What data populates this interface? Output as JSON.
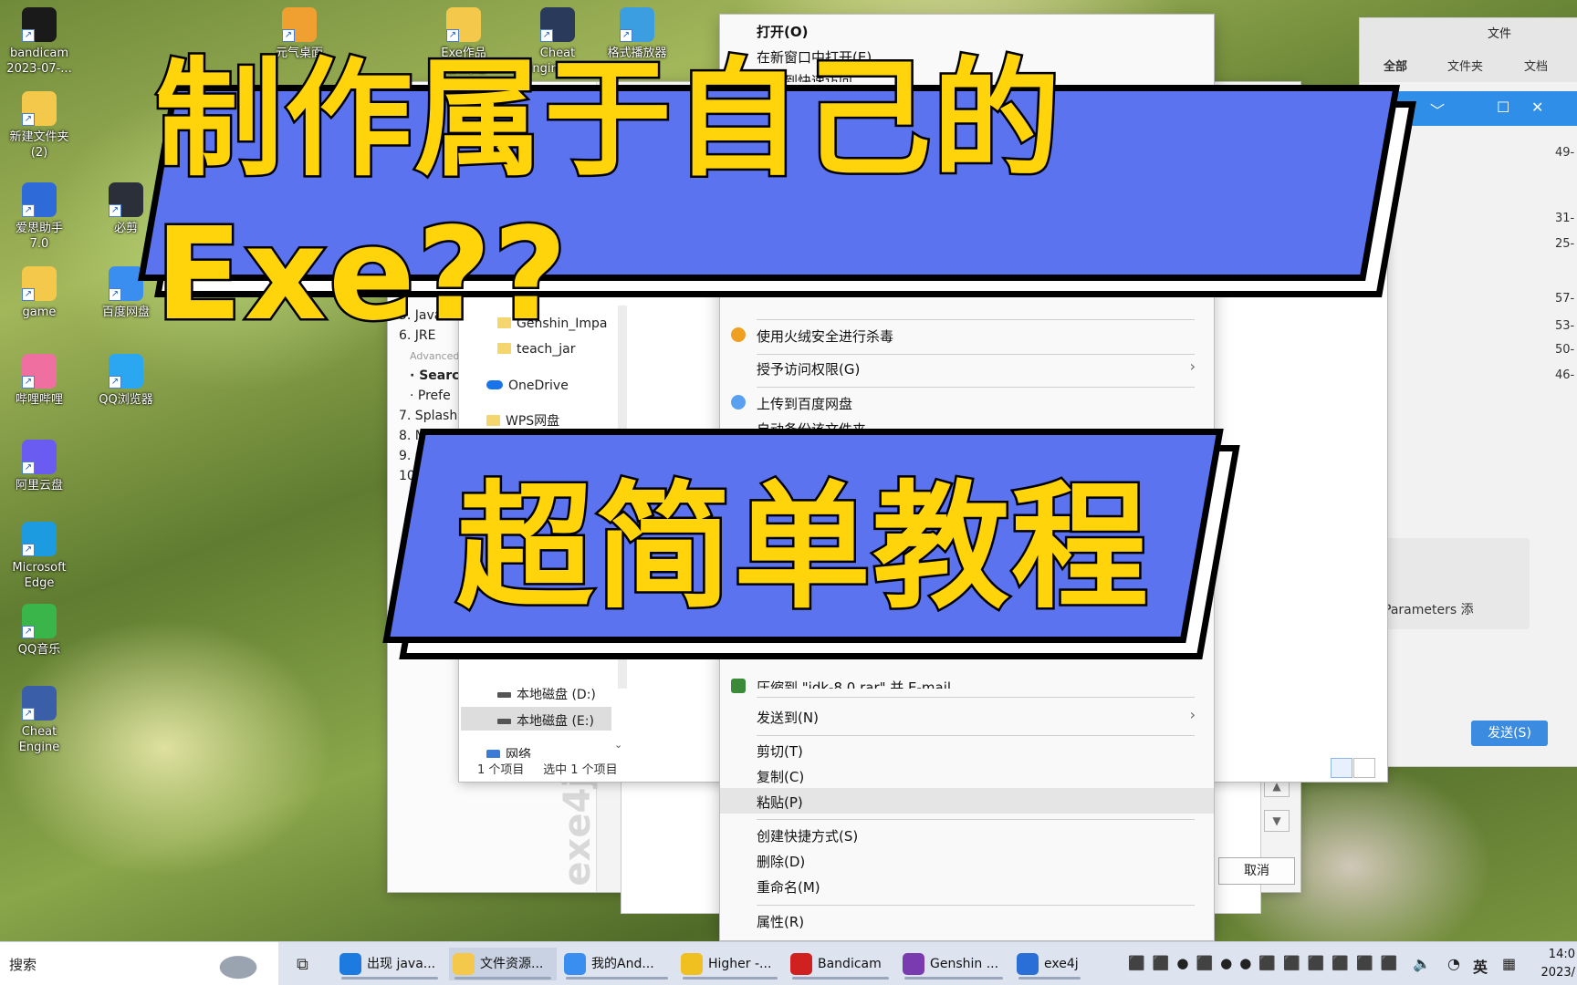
{
  "desktop_icons": [
    {
      "label": "bandicam\n2023-07-...",
      "color": "#1a1a1a"
    },
    {
      "label": "新建文件夹\n(2)",
      "color": "#f3c84b"
    },
    {
      "label": "爱思助手\n7.0",
      "color": "#2f6bd8"
    },
    {
      "label": "必剪",
      "color": "#2b2f3a"
    },
    {
      "label": "game",
      "color": "#f3c84b"
    },
    {
      "label": "百度网盘",
      "color": "#3a8ef0"
    },
    {
      "label": "哔哩哔哩",
      "color": "#ef6fa0"
    },
    {
      "label": "QQ浏览器",
      "color": "#2ba6f0"
    },
    {
      "label": "阿里云盘",
      "color": "#6a5cf0"
    },
    {
      "label": "Microsoft\nEdge",
      "color": "#1d9be0"
    },
    {
      "label": "QQ音乐",
      "color": "#39b54a"
    },
    {
      "label": "Cheat\nEngine",
      "color": "#3a5fa8"
    },
    {
      "label": "元气桌面",
      "color": "#f0a030"
    },
    {
      "label": "Exe作品\n(已做)运",
      "color": "#f3c84b"
    },
    {
      "label": "Cheat\nEngine.exe",
      "color": "#2a3a5a"
    },
    {
      "label": "格式播放器",
      "color": "#3a9ee0"
    }
  ],
  "exe4j": {
    "brand": "exe4j",
    "steps": [
      "5. Java in",
      "6. JRE",
      "Advanced",
      "· Searc",
      "· Prefe",
      "7. Splash",
      "8. Mes",
      "9. Cor",
      "10. Fi"
    ],
    "cancel": "取消"
  },
  "explorer": {
    "nav": [
      {
        "label": "Genshin_Impa",
        "icon": "folder"
      },
      {
        "label": "teach_jar",
        "icon": "folder"
      },
      {
        "label": "OneDrive",
        "icon": "cloud"
      },
      {
        "label": "WPS网盘",
        "icon": "folder"
      },
      {
        "label": "本地磁盘 (D:)",
        "icon": "drive"
      },
      {
        "label": "本地磁盘 (E:)",
        "icon": "drive"
      },
      {
        "label": "网络",
        "icon": "net"
      }
    ],
    "status_count": "1 个项目",
    "status_selected": "选中 1 个项目"
  },
  "chat": {
    "title": "文件",
    "tabs": [
      "全部",
      "文件夹",
      "文档"
    ],
    "side_nums": [
      "49-",
      "31-",
      "25-",
      "57-",
      "53-",
      "50-",
      "46-"
    ],
    "card_text": "Parameters 添",
    "send": "发送(S)",
    "controls": [
      "﹀",
      "☐",
      "✕"
    ]
  },
  "context_menu": {
    "items": [
      {
        "label": "打开(O)",
        "bold": true
      },
      {
        "label": "在新窗口中打开(E)"
      },
      {
        "label": "固定到快速访问"
      },
      {
        "label": "使用火绒安全进行杀毒",
        "icon": "#f0a020"
      },
      {
        "label": "授予访问权限(G)",
        "submenu": true
      },
      {
        "label": "上传到百度网盘",
        "icon": "#5aa0f0"
      },
      {
        "label": "自动备份该文件夹"
      },
      {
        "label": "压缩到 \"jdk-8.0.rar\" 并 E-mail",
        "icon": "#3a8a3a"
      },
      {
        "label": "发送到(N)",
        "submenu": true
      },
      {
        "label": "剪切(T)"
      },
      {
        "label": "复制(C)"
      },
      {
        "label": "粘贴(P)"
      },
      {
        "label": "创建快捷方式(S)"
      },
      {
        "label": "删除(D)"
      },
      {
        "label": "重命名(M)"
      },
      {
        "label": "属性(R)"
      }
    ]
  },
  "banners": {
    "title": "制作属于自己的Exe??",
    "subtitle": "超简单教程"
  },
  "taskbar": {
    "search": "搜索",
    "apps": [
      {
        "label": "出现 java...",
        "color": "#1d7be0"
      },
      {
        "label": "文件资源...",
        "color": "#f3c84b"
      },
      {
        "label": "我的And...",
        "color": "#3a8ef0"
      },
      {
        "label": "Higher -...",
        "color": "#f0c020"
      },
      {
        "label": "Bandicam",
        "color": "#d02020"
      },
      {
        "label": "Genshin ...",
        "color": "#7a3ab0"
      },
      {
        "label": "exe4j",
        "color": "#2a6ed8"
      }
    ],
    "ime": "英",
    "time": "14:0",
    "date": "2023/"
  }
}
